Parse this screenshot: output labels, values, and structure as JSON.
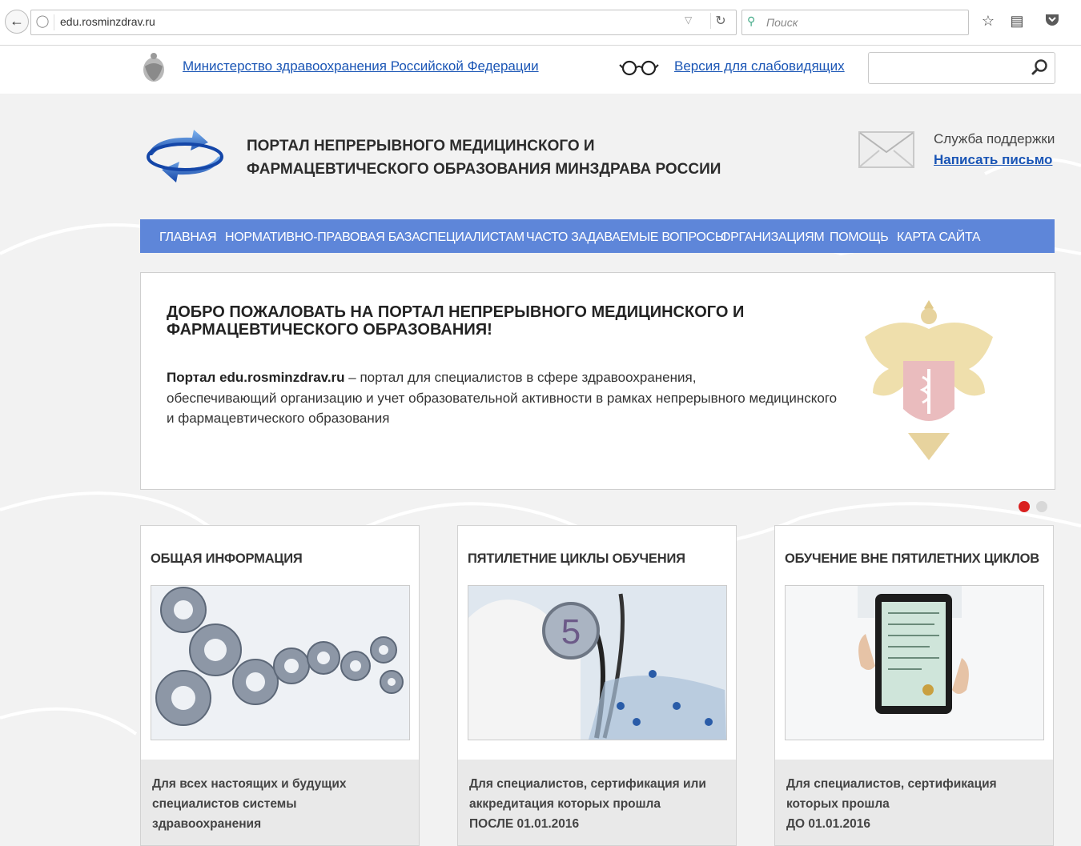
{
  "browser": {
    "url": "edu.rosminzdrav.ru",
    "search_placeholder": "Поиск"
  },
  "ministry": {
    "link": "Министерство здравоохранения Российской Федерации",
    "low_vision": "Версия для слабовидящих",
    "search_value": ""
  },
  "header": {
    "title_line1": "ПОРТАЛ НЕПРЕРЫВНОГО МЕДИЦИНСКОГО И",
    "title_line2": "ФАРМАЦЕВТИЧЕСКОГО ОБРАЗОВАНИЯ МИНЗДРАВА РОССИИ",
    "support_label": "Служба поддержки",
    "write_link": "Написать письмо"
  },
  "nav": {
    "items": [
      "ГЛАВНАЯ",
      "НОРМАТИВНО-ПРАВОВАЯ БАЗА",
      "СПЕЦИАЛИСТАМ",
      "ЧАСТО ЗАДАВАЕМЫЕ ВОПРОСЫ",
      "ОРГАНИЗАЦИЯМ",
      "ПОМОЩЬ",
      "КАРТА САЙТА"
    ]
  },
  "welcome": {
    "title_line1": "ДОБРО ПОЖАЛОВАТЬ НА ПОРТАЛ НЕПРЕРЫВНОГО МЕДИЦИНСКОГО И",
    "title_line2": "ФАРМАЦЕВТИЧЕСКОГО ОБРАЗОВАНИЯ!",
    "text_bold": "Портал edu.rosminzdrav.ru",
    "text_line1": " – портал для специалистов в сфере здравоохранения,",
    "text_line2": "обеспечивающий организацию и учет образовательной активности в рамках непрерывного медицинского",
    "text_line3": "и фармацевтического образования"
  },
  "slider": {
    "active_color": "#d9201f",
    "inactive_color": "#d8d8d8"
  },
  "cards": [
    {
      "title": "ОБЩАЯ ИНФОРМАЦИЯ",
      "desc_line1": "Для всех настоящих и будущих",
      "desc_line2": "специалистов системы",
      "desc_line3": "здравоохранения"
    },
    {
      "title": "ПЯТИЛЕТНИЕ ЦИКЛЫ ОБУЧЕНИЯ",
      "desc_line1": "Для специалистов, сертификация или",
      "desc_line2": "аккредитация которых прошла",
      "desc_line3": "ПОСЛЕ 01.01.2016",
      "image_number": "5"
    },
    {
      "title": "ОБУЧЕНИЕ ВНЕ ПЯТИЛЕТНИХ ЦИКЛОВ",
      "desc_line1": "Для специалистов, сертификация",
      "desc_line2": "которых прошла",
      "desc_line3": "ДО 01.01.2016"
    }
  ],
  "colors": {
    "nav_bg": "#5e86d9",
    "link": "#1a55b5"
  }
}
